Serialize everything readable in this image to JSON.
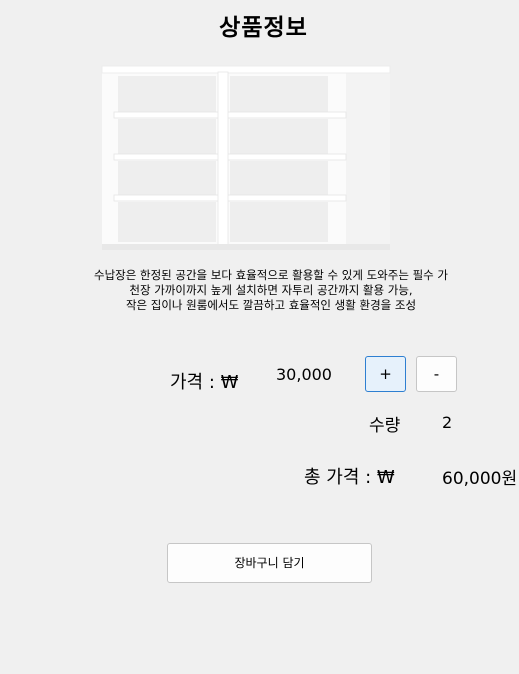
{
  "header": {
    "title": "상품정보"
  },
  "product": {
    "image_alt": "white-shelf-icon",
    "description_lines": [
      "수납장은 한정된 공간을 보다 효율적으로 활용할 수 있게 도와주는 필수 가",
      "천장 가까이까지 높게 설치하면 자투리 공간까지 활용 가능,",
      "작은 집이나 원룸에서도 깔끔하고 효율적인 생활 환경을 조성"
    ]
  },
  "price": {
    "label": "가격 : ₩",
    "value": "30,000"
  },
  "controls": {
    "plus": "+",
    "minus": "-"
  },
  "quantity": {
    "label": "수량",
    "value": "2"
  },
  "total": {
    "label": "총 가격 : ₩",
    "value": "60,000원"
  },
  "cart": {
    "button_label": "장바구니 담기"
  }
}
